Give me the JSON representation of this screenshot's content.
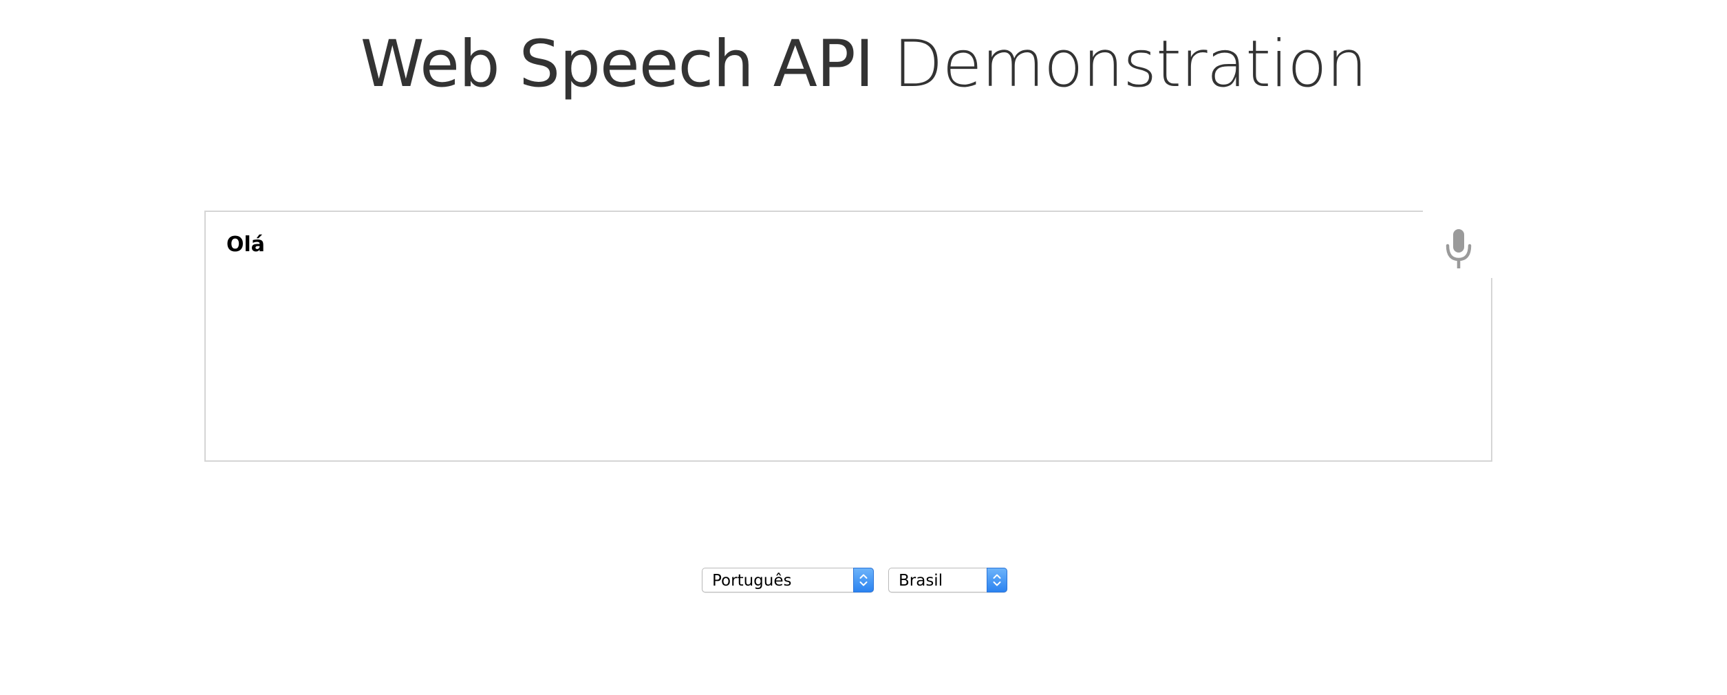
{
  "header": {
    "title_strong": "Web Speech API",
    "title_light": "Demonstration"
  },
  "results": {
    "final_text": "Olá",
    "interim_text": ""
  },
  "mic_button": {
    "icon": "microphone-icon"
  },
  "language_select": {
    "selected": "Português",
    "icon": "select-stepper-icon"
  },
  "dialect_select": {
    "selected": "Brasil",
    "icon": "select-stepper-icon"
  },
  "colors": {
    "title": "#333333",
    "box_border": "#d5d5d5",
    "mic_icon": "#9a9a9a",
    "select_accent": "#2b83f0"
  }
}
